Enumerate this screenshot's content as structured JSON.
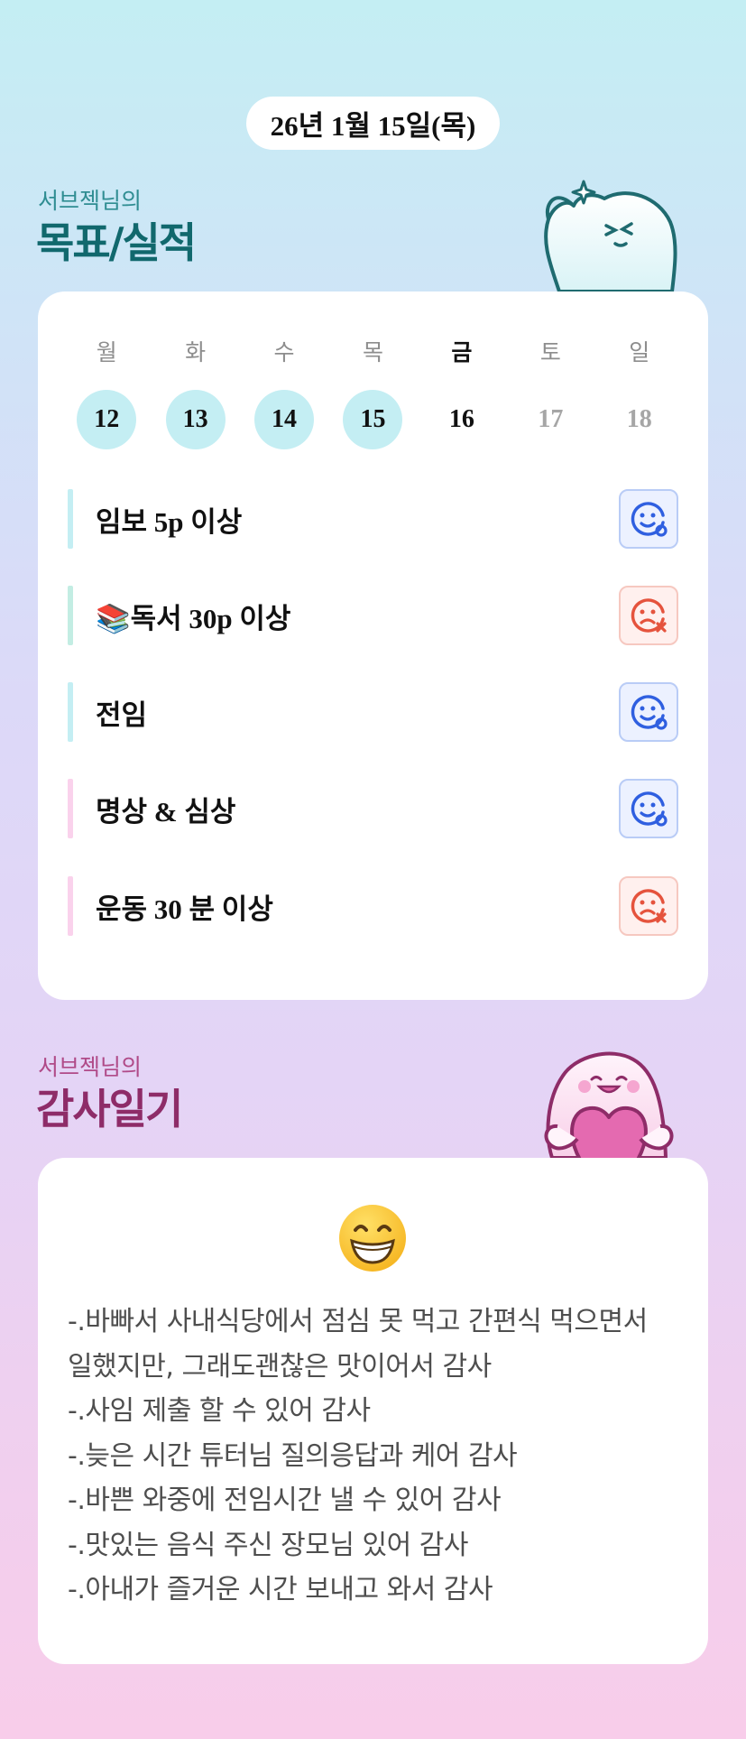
{
  "header": {
    "date": "26년 1월 15일(목)"
  },
  "goals_section": {
    "subtitle": "서브젝님의",
    "title": "목표/실적"
  },
  "week": {
    "weekdays": [
      "월",
      "화",
      "수",
      "목",
      "금",
      "토",
      "일"
    ],
    "dates": [
      "12",
      "13",
      "14",
      "15",
      "16",
      "17",
      "18"
    ],
    "today_index": 4
  },
  "goals": [
    {
      "label": "임보 5p 이상",
      "emoji": "",
      "status": "success",
      "bar_color": "#c4eef3"
    },
    {
      "label": "독서 30p  이상",
      "emoji": "📚",
      "status": "fail",
      "bar_color": "#c3ede3"
    },
    {
      "label": "전임",
      "emoji": "",
      "status": "success",
      "bar_color": "#c4eef3"
    },
    {
      "label": "명상 & 심상",
      "emoji": "",
      "status": "success",
      "bar_color": "#fad2ec"
    },
    {
      "label": "운동 30 분 이상",
      "emoji": "",
      "status": "fail",
      "bar_color": "#fad2ec"
    }
  ],
  "gratitude_section": {
    "subtitle": "서브젝님의",
    "title": "감사일기",
    "mood_icon": "grinning-face",
    "lines": [
      "-.바빠서 사내식당에서 점심 못 먹고 간편식 먹으면서",
      "일했지만, 그래도괜찮은 맛이어서 감사",
      "-.사임 제출 할 수 있어 감사",
      "-.늦은 시간 튜터님 질의응답과 케어 감사",
      "-.바쁜 와중에 전임시간 낼 수 있어 감사",
      "-.맛있는 음식 주신 장모님 있어 감사",
      "-.아내가 즐거운 시간 보내고 와서 감사"
    ]
  },
  "colors": {
    "goal_title": "#11686d",
    "gratitude_title": "#8e2c68",
    "done_circle": "#c4eef3",
    "success_icon": "#2f5fe0",
    "fail_icon": "#e5533d"
  }
}
